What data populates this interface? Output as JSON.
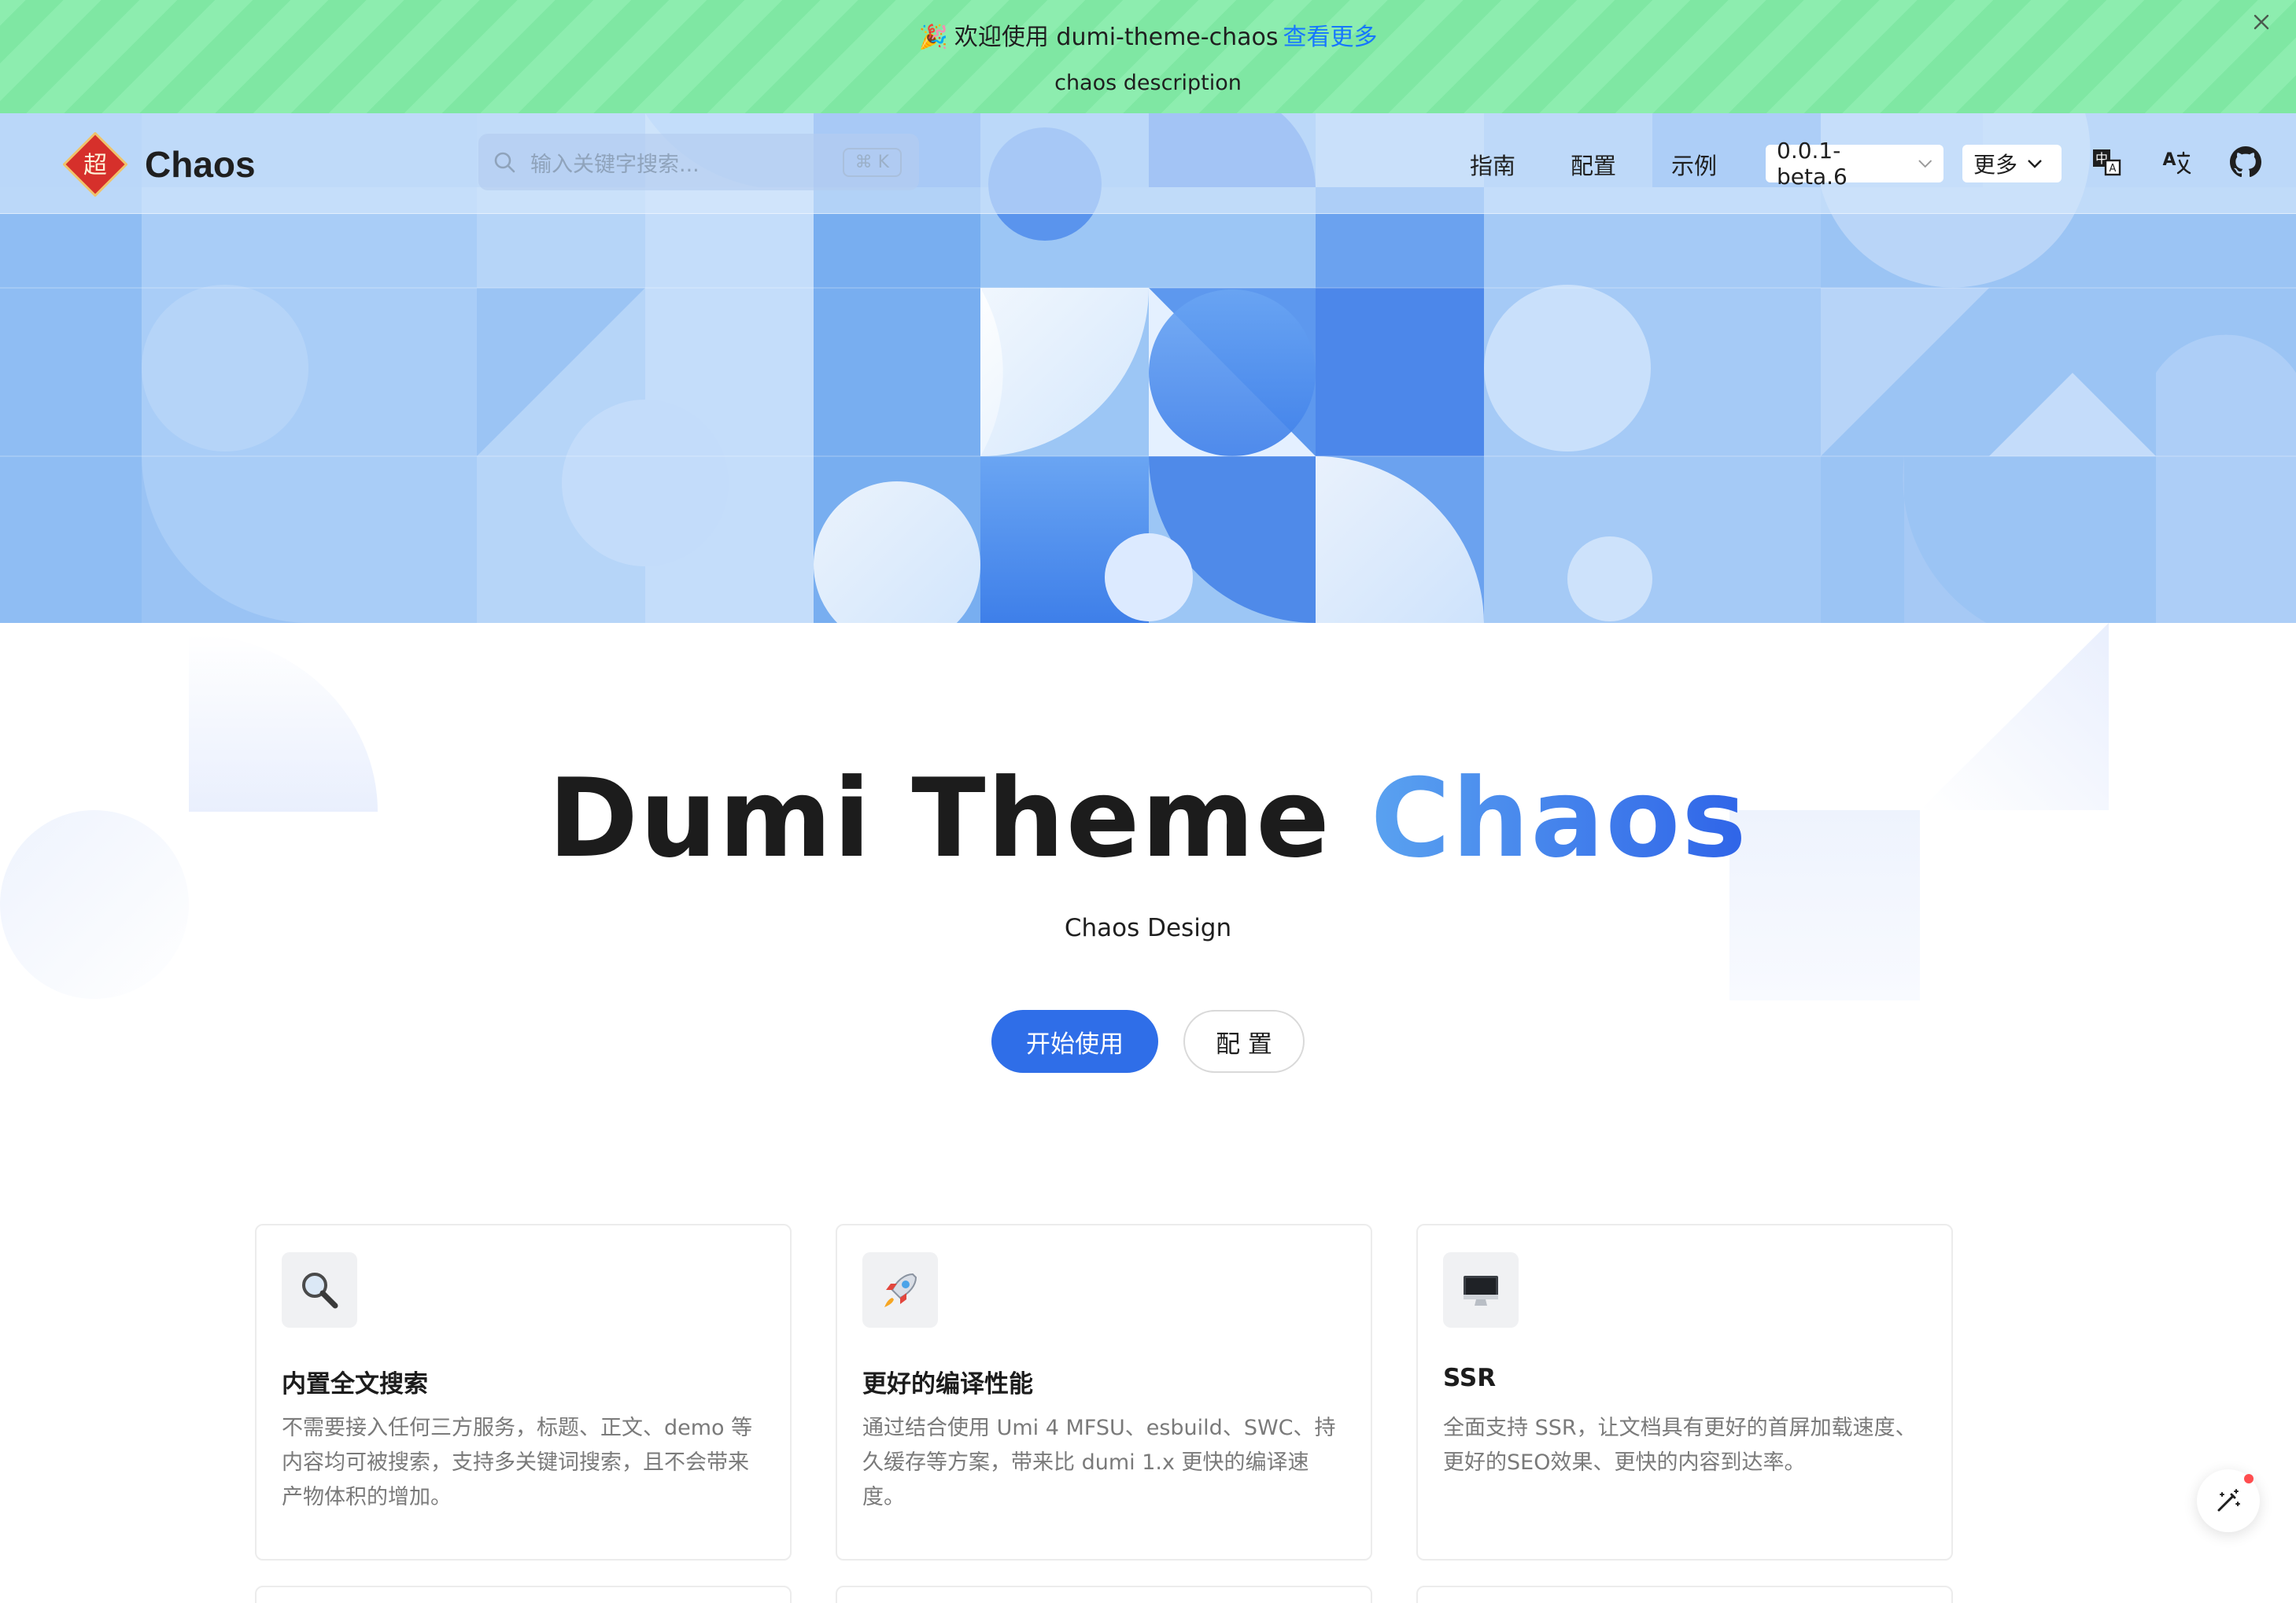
{
  "announcement": {
    "emoji": "🎉",
    "text": "欢迎使用 dumi-theme-chaos",
    "link_label": "查看更多",
    "description": "chaos description"
  },
  "header": {
    "logo_char": "超",
    "brand": "Chaos",
    "search": {
      "placeholder": "输入关键字搜索...",
      "shortcut": "⌘ K"
    },
    "nav": [
      "指南",
      "配置",
      "示例"
    ],
    "version_select": "0.0.1-beta.6",
    "more_select": "更多",
    "icons": [
      "language-switch-icon",
      "translate-icon",
      "github-icon"
    ]
  },
  "hero": {
    "title_main": "Dumi Theme",
    "title_accent": "Chaos",
    "subtitle": "Chaos Design",
    "primary_button": "开始使用",
    "secondary_button": "配 置"
  },
  "features": [
    {
      "icon": "🔍",
      "icon_name": "magnifier-icon",
      "title": "内置全文搜索",
      "desc": "不需要接入任何三方服务，标题、正文、demo 等内容均可被搜索，支持多关键词搜索，且不会带来产物体积的增加。"
    },
    {
      "icon": "🚀",
      "icon_name": "rocket-icon",
      "title": "更好的编译性能",
      "desc": "通过结合使用 Umi 4 MFSU、esbuild、SWC、持久缓存等方案，带来比 dumi 1.x 更快的编译速度。"
    },
    {
      "icon": "🖥",
      "icon_name": "desktop-computer-icon",
      "title": "SSR",
      "desc": "全面支持 SSR，让文档具有更好的首屏加载速度、更好的SEO效果、更快的内容到达率。"
    }
  ],
  "colors": {
    "accent": "#2f6ee8",
    "announcement_bg": "#7fe7a3",
    "banner_blue": "#9cc6f5",
    "link": "#1677ff"
  }
}
